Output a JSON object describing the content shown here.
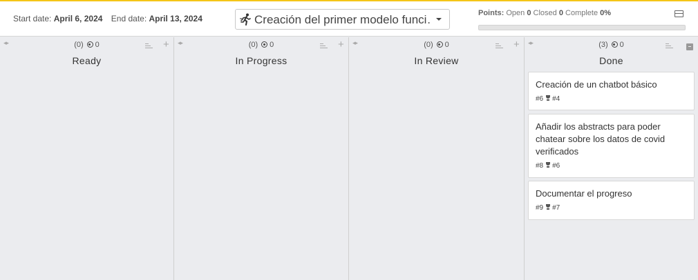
{
  "header": {
    "start_label": "Start date:",
    "start_value": "April 6, 2024",
    "end_label": "End date:",
    "end_value": "April 13, 2024",
    "milestone": {
      "icon": "running-person-icon",
      "text": "Creación del primer modelo funci…"
    },
    "points": {
      "label": "Points:",
      "open_label": "Open",
      "open_value": "0",
      "closed_label": "Closed",
      "closed_value": "0",
      "complete_label": "Complete",
      "complete_value": "0%",
      "progress_fraction": 0
    }
  },
  "columns": [
    {
      "title": "Ready",
      "count": "(0)",
      "points": "0",
      "cards": []
    },
    {
      "title": "In Progress",
      "count": "(0)",
      "points": "0",
      "cards": []
    },
    {
      "title": "In Review",
      "count": "(0)",
      "points": "0",
      "cards": []
    },
    {
      "title": "Done",
      "count": "(3)",
      "points": "0",
      "cards": [
        {
          "title": "Creación de un chatbot básico",
          "id": "#6",
          "milestone": "#4"
        },
        {
          "title": "Añadir los abstracts para poder chatear sobre los datos de covid verificados",
          "id": "#8",
          "milestone": "#6"
        },
        {
          "title": "Documentar el progreso",
          "id": "#9",
          "milestone": "#7"
        }
      ]
    }
  ],
  "colors": {
    "accent": "#f5c518",
    "board_bg": "#ebecef"
  }
}
